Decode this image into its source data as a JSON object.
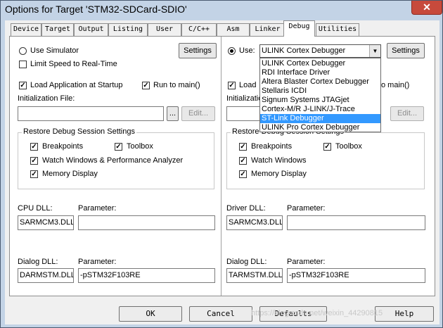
{
  "window": {
    "title": "Options for Target 'STM32-SDCard-SDIO'",
    "close_glyph": "✕"
  },
  "tabs": [
    "Device",
    "Target",
    "Output",
    "Listing",
    "User",
    "C/C++",
    "Asm",
    "Linker",
    "Debug",
    "Utilities"
  ],
  "active_tab": "Debug",
  "left": {
    "use_simulator": "Use Simulator",
    "settings_label": "Settings",
    "limit_speed": "Limit Speed to Real-Time",
    "load_app": "Load Application at Startup",
    "run_to_main": "Run to main()",
    "init_file_label": "Initialization File:",
    "browse_label": "...",
    "edit_label": "Edit...",
    "restore_group": "Restore Debug Session Settings",
    "breakpoints": "Breakpoints",
    "toolbox": "Toolbox",
    "watch_windows": "Watch Windows & Performance Analyzer",
    "memory_display": "Memory Display",
    "dll_label": "CPU DLL:",
    "parameter_label": "Parameter:",
    "dll_value": "SARMCM3.DLL",
    "dll_param": "",
    "dialog_dll_label": "Dialog DLL:",
    "dialog_dll_value": "DARMSTM.DLL",
    "dialog_param": "-pSTM32F103RE"
  },
  "right": {
    "use_label": "Use:",
    "debugger_value": "ULINK Cortex Debugger",
    "settings_label": "Settings",
    "load_app": "Load",
    "run_to_main": "o main()",
    "init_file_label": "Initializatio",
    "edit_label": "Edit...",
    "restore_group": "Restore Debug Session Settings",
    "breakpoints": "Breakpoints",
    "toolbox": "Toolbox",
    "watch_windows": "Watch Windows",
    "memory_display": "Memory Display",
    "dll_label": "Driver DLL:",
    "parameter_label": "Parameter:",
    "dll_value": "SARMCM3.DLL",
    "dll_param": "",
    "dialog_dll_label": "Dialog DLL:",
    "dialog_dll_value": "TARMSTM.DLL",
    "dialog_param": "-pSTM32F103RE"
  },
  "dropdown": {
    "options": [
      "ULINK Cortex Debugger",
      "RDI Interface Driver",
      "Altera Blaster Cortex Debugger",
      "Stellaris ICDI",
      "Signum Systems JTAGjet",
      "Cortex-M/R J-LINK/J-Trace",
      "ST-Link Debugger",
      "ULINK Pro Cortex Debugger"
    ],
    "selected": "ST-Link Debugger"
  },
  "bottom": {
    "ok": "OK",
    "cancel": "Cancel",
    "defaults": "Defaults",
    "help": "Help"
  },
  "watermark": "https://blog.csdn.net/weixin_44290815",
  "colors": {
    "highlight": "#3399ff",
    "title_bg": "#c3d3e6",
    "close": "#c74a3c"
  }
}
